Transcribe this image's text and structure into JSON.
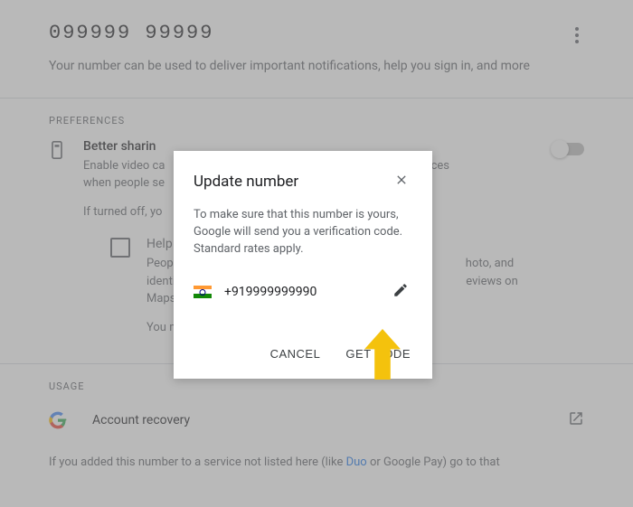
{
  "header": {
    "phone_display": "099999  99999",
    "subtext": "Your number can be used to deliver important notifications, help you sign in, and more"
  },
  "sections": {
    "preferences_label": "PREFERENCES",
    "better_sharing": {
      "title": "Better sharin",
      "desc1_a": "Enable video ca",
      "desc1_b": "e services",
      "desc2": "when people se",
      "desc3": "If turned off, yo"
    },
    "help": {
      "title": "Help pec",
      "line1_a": "People w",
      "line1_b": "hoto, and",
      "line2_a": "identify th",
      "line2_b": "eviews on",
      "line3": "Maps & c",
      "line4": "You must"
    },
    "usage_label": "USAGE",
    "usage_item": "Account recovery",
    "usage_note_pre": "If you added this number to a service not listed here (like ",
    "usage_note_link": "Duo",
    "usage_note_post": " or Google Pay) go to that"
  },
  "dialog": {
    "title": "Update number",
    "body": "To make sure that this number is yours, Google will send you a verification code. Standard rates apply.",
    "phone": "+919999999990",
    "cancel": "CANCEL",
    "get_code": "GET CODE"
  }
}
